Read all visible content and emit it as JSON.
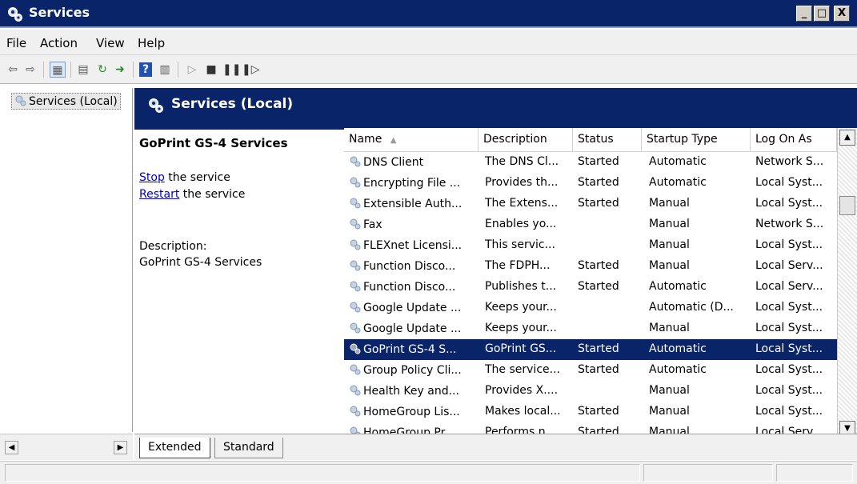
{
  "window": {
    "title": "Services",
    "min_label": "_",
    "max_label": "□",
    "close_label": "X"
  },
  "menu": [
    "File",
    "Action",
    "View",
    "Help"
  ],
  "tree": {
    "root_label": "Services (Local)"
  },
  "panel_header": {
    "title": "Services (Local)"
  },
  "detail": {
    "service_name": "GoPrint GS-4 Services",
    "stop_link": "Stop",
    "stop_suffix": " the service",
    "restart_link": "Restart",
    "restart_suffix": " the service",
    "description_label": "Description:",
    "description_text": "GoPrint GS-4 Services"
  },
  "columns": [
    {
      "label": "Name",
      "sort": "ascending"
    },
    {
      "label": "Description"
    },
    {
      "label": "Status"
    },
    {
      "label": "Startup Type"
    },
    {
      "label": "Log On As"
    }
  ],
  "rows": [
    {
      "name": "DNS Client",
      "description": "The DNS Cl...",
      "status": "Started",
      "startup": "Automatic",
      "logon": "Network S..."
    },
    {
      "name": "Encrypting File ...",
      "description": "Provides th...",
      "status": "Started",
      "startup": "Automatic",
      "logon": "Local Syst..."
    },
    {
      "name": "Extensible Auth...",
      "description": "The Extens...",
      "status": "Started",
      "startup": "Manual",
      "logon": "Local Syst..."
    },
    {
      "name": "Fax",
      "description": "Enables yo...",
      "status": "",
      "startup": "Manual",
      "logon": "Network S..."
    },
    {
      "name": "FLEXnet Licensi...",
      "description": "This servic...",
      "status": "",
      "startup": "Manual",
      "logon": "Local Syst..."
    },
    {
      "name": "Function Disco...",
      "description": "The FDPH...",
      "status": "Started",
      "startup": "Manual",
      "logon": "Local Serv..."
    },
    {
      "name": "Function Disco...",
      "description": "Publishes t...",
      "status": "Started",
      "startup": "Automatic",
      "logon": "Local Serv..."
    },
    {
      "name": "Google Update ...",
      "description": "Keeps your...",
      "status": "",
      "startup": "Automatic (D...",
      "logon": "Local Syst..."
    },
    {
      "name": "Google Update ...",
      "description": "Keeps your...",
      "status": "",
      "startup": "Manual",
      "logon": "Local Syst..."
    },
    {
      "name": "GoPrint GS-4 S...",
      "description": "GoPrint GS...",
      "status": "Started",
      "startup": "Automatic",
      "logon": "Local Syst...",
      "selected": true
    },
    {
      "name": "Group Policy Cli...",
      "description": "The service...",
      "status": "Started",
      "startup": "Automatic",
      "logon": "Local Syst..."
    },
    {
      "name": "Health Key and...",
      "description": "Provides X....",
      "status": "",
      "startup": "Manual",
      "logon": "Local Syst..."
    },
    {
      "name": "HomeGroup Lis...",
      "description": "Makes local...",
      "status": "Started",
      "startup": "Manual",
      "logon": "Local Syst..."
    },
    {
      "name": "HomeGroup Pr...",
      "description": "Performs n...",
      "status": "Started",
      "startup": "Manual",
      "logon": "Local Serv..."
    }
  ],
  "tabs": [
    "Extended",
    "Standard"
  ],
  "colors": {
    "selection": "#0a246a",
    "header": "#0a246a",
    "link": "#0000cc"
  }
}
